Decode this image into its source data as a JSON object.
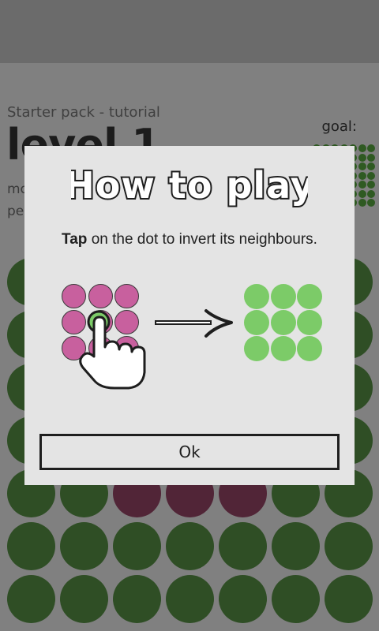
{
  "header": {
    "pack_title": "Starter pack - tutorial",
    "level_title": "level 1",
    "goal_label": "goal:",
    "moves_label": "mo",
    "perfect_label": "pe"
  },
  "board": {
    "rows": 7,
    "cols": 7,
    "highlight_row": 4,
    "off_cols": [
      2,
      3,
      4
    ],
    "colors": {
      "on": "#2f4e25",
      "off": "#512537"
    }
  },
  "dialog": {
    "title": "How to play",
    "instruction_bold": "Tap",
    "instruction_rest": "on the dot to invert its neighbours.",
    "ok_label": "Ok",
    "colors": {
      "before": "#c8609e",
      "after": "#7ccb68",
      "background": "#e4e4e4"
    }
  }
}
